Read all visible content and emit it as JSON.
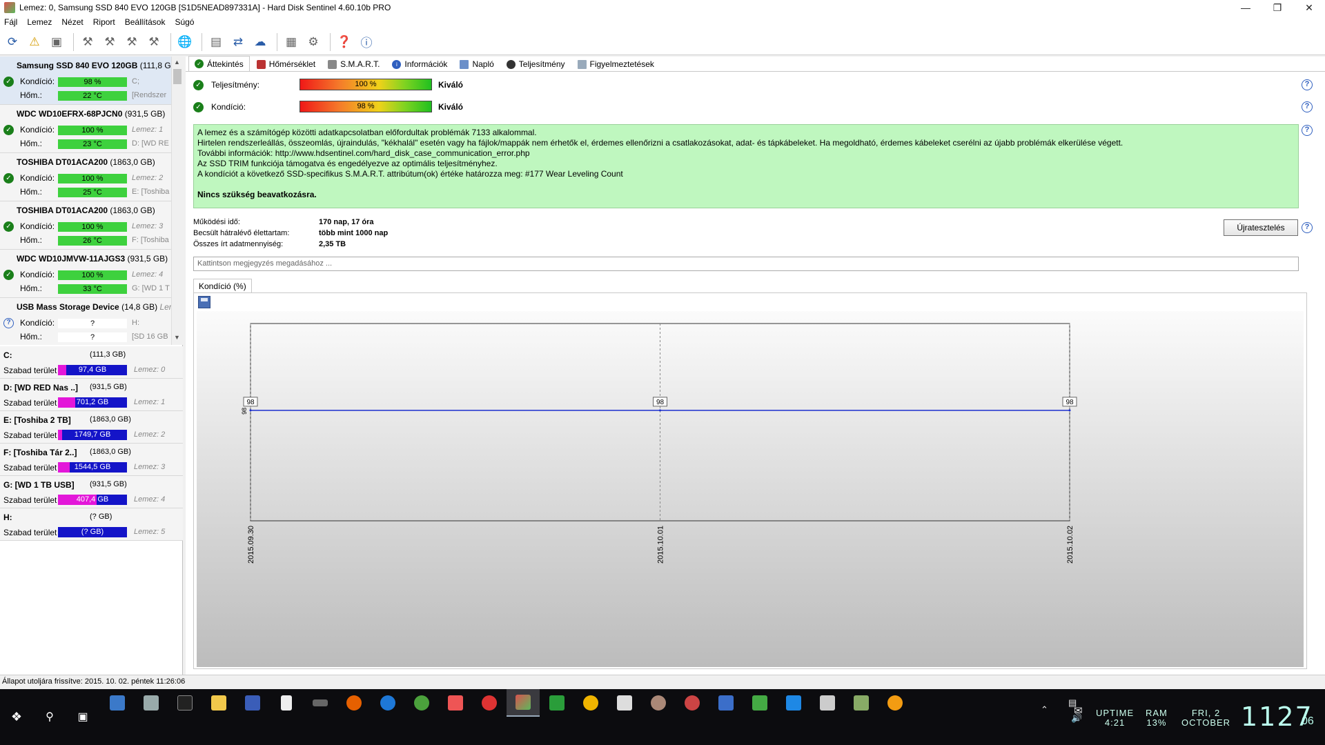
{
  "window": {
    "title": "Lemez: 0, Samsung SSD 840 EVO 120GB [S1D5NEAD897331A] -  Hard Disk Sentinel 4.60.10b PRO"
  },
  "menu": [
    "Fájl",
    "Lemez",
    "Nézet",
    "Riport",
    "Beállítások",
    "Súgó"
  ],
  "disks": [
    {
      "name": "Samsung SSD 840 EVO 120GB",
      "size": "(111,8 GB)",
      "health_label": "Kondíció:",
      "health": "98 %",
      "temp_label": "Hőm.:",
      "temp": "22 °C",
      "side1": "C;",
      "side2": "[Rendszer",
      "status": "ok"
    },
    {
      "name": "WDC WD10EFRX-68PJCN0",
      "size": "(931,5 GB)",
      "health_label": "Kondíció:",
      "health": "100 %",
      "temp_label": "Hőm.:",
      "temp": "23 °C",
      "side1": "Lemez: 1",
      "side2": "D: [WD RE",
      "status": "ok"
    },
    {
      "name": "TOSHIBA DT01ACA200",
      "size": "(1863,0 GB)",
      "health_label": "Kondíció:",
      "health": "100 %",
      "temp_label": "Hőm.:",
      "temp": "25 °C",
      "side1": "Lemez: 2",
      "side2": "E: [Toshiba",
      "status": "ok"
    },
    {
      "name": "TOSHIBA DT01ACA200",
      "size": "(1863,0 GB)",
      "health_label": "Kondíció:",
      "health": "100 %",
      "temp_label": "Hőm.:",
      "temp": "26 °C",
      "side1": "Lemez: 3",
      "side2": "F: [Toshiba",
      "status": "ok"
    },
    {
      "name": "WDC WD10JMVW-11AJGS3",
      "size": "(931,5 GB)",
      "health_label": "Kondíció:",
      "health": "100 %",
      "temp_label": "Hőm.:",
      "temp": "33 °C",
      "side1": "Lemez: 4",
      "side2": "G: [WD 1 T",
      "status": "ok"
    },
    {
      "name": "USB Mass Storage Device",
      "size": "(14,8 GB)",
      "health_label": "Kondíció:",
      "health": "?",
      "temp_label": "Hőm.:",
      "temp": "?",
      "side1": "H:",
      "side2": "[SD 16 GB",
      "side0": "Lem",
      "status": "unknown"
    }
  ],
  "partitions": [
    {
      "name": "C:",
      "size": "(111,3 GB)",
      "free_label": "Szabad terület",
      "free": "97,4 GB",
      "disk": "Lemez: 0",
      "used_fraction": 0.12
    },
    {
      "name": "D: [WD RED Nas ..]",
      "size": "(931,5 GB)",
      "free_label": "Szabad terület",
      "free": "701,2 GB",
      "disk": "Lemez: 1",
      "used_fraction": 0.25
    },
    {
      "name": "E: [Toshiba 2 TB]",
      "size": "(1863,0 GB)",
      "free_label": "Szabad terület",
      "free": "1749,7 GB",
      "disk": "Lemez: 2",
      "used_fraction": 0.06
    },
    {
      "name": "F: [Toshiba Tár 2..]",
      "size": "(1863,0 GB)",
      "free_label": "Szabad terület",
      "free": "1544,5 GB",
      "disk": "Lemez: 3",
      "used_fraction": 0.17
    },
    {
      "name": "G: [WD 1 TB USB]",
      "size": "(931,5 GB)",
      "free_label": "Szabad terület",
      "free": "407,4 GB",
      "disk": "Lemez: 4",
      "used_fraction": 0.56
    },
    {
      "name": "H:",
      "size": "(? GB)",
      "free_label": "Szabad terület",
      "free": "(? GB)",
      "disk": "Lemez: 5",
      "used_fraction": 1.0
    }
  ],
  "tabs": [
    "Áttekintés",
    "Hőmérséklet",
    "S.M.A.R.T.",
    "Információk",
    "Napló",
    "Teljesítmény",
    "Figyelmeztetések"
  ],
  "overview": {
    "performance_label": "Teljesítmény:",
    "performance_value": "100 %",
    "performance_result": "Kiváló",
    "health_label": "Kondíció:",
    "health_value": "98 %",
    "health_result": "Kiváló",
    "info_lines": [
      "A lemez és a számítógép közötti adatkapcsolatban előfordultak problémák 7133 alkalommal.",
      "Hirtelen rendszerleállás, összeomlás, újraindulás, \"kékhalál\" esetén vagy ha fájlok/mappák nem érhetők el, érdemes ellenőrizni a csatlakozásokat, adat- és tápkábeleket. Ha megoldható, érdemes kábeleket cserélni az újabb problémák elkerülése végett.",
      "További információk: http://www.hdsentinel.com/hard_disk_case_communication_error.php",
      "Az SSD TRIM funkciója támogatva és engedélyezve az optimális teljesítményhez.",
      "A kondíciót a következő SSD-specifikus S.M.A.R.T. attribútum(ok) értéke határozza meg:  #177 Wear Leveling Count"
    ],
    "info_action": "Nincs szükség beavatkozásra.",
    "uptime_label": "Működési idő:",
    "uptime_value": "170 nap, 17 óra",
    "remaining_label": "Becsült hátralévő élettartam:",
    "remaining_value": "több mint 1000 nap",
    "written_label": "Összes írt adatmennyiség:",
    "written_value": "2,35 TB",
    "retest_button": "Újratesztelés",
    "note_placeholder": "Kattintson megjegyzés megadásához ..."
  },
  "chart_tab_label": "Kondíció  (%)",
  "chart_data": {
    "type": "line",
    "x": [
      "2015.09.30",
      "2015.10.01",
      "2015.10.02"
    ],
    "series": [
      {
        "values": [
          98,
          98,
          98
        ],
        "color": "#1a2fcf"
      }
    ],
    "y_tick_label": "98",
    "grid": true
  },
  "status_bar": "Állapot utoljára frissítve: 2015. 10. 02. péntek 11:26:06",
  "taskbar": {
    "uptime_label": "UPTIME",
    "uptime_value": "4:21",
    "ram_label": "RAM",
    "ram_value": "13%",
    "day": "FRI, 2",
    "month": "OCTOBER",
    "time": "1127",
    "seconds": "06"
  }
}
